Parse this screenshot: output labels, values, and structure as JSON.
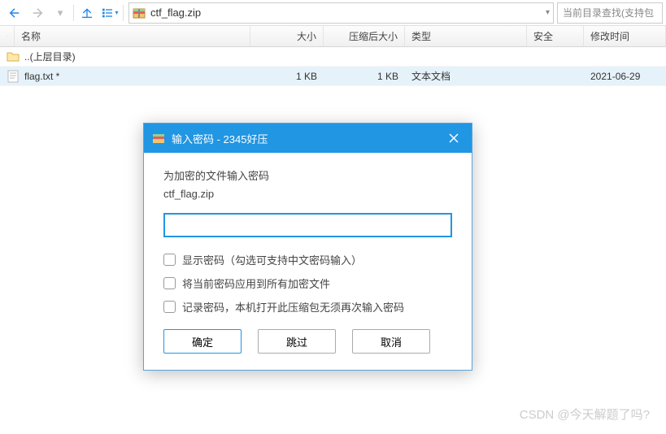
{
  "toolbar": {
    "path": "ctf_flag.zip",
    "search_placeholder": "当前目录查找(支持包"
  },
  "columns": {
    "name": "名称",
    "size": "大小",
    "csize": "压缩后大小",
    "type": "类型",
    "safe": "安全",
    "time": "修改时间"
  },
  "rows": [
    {
      "name": "..(上层目录)",
      "size": "",
      "csize": "",
      "type": "",
      "safe": "",
      "time": "",
      "icon": "folder"
    },
    {
      "name": "flag.txt *",
      "size": "1 KB",
      "csize": "1 KB",
      "type": "文本文档",
      "safe": "",
      "time": "2021-06-29",
      "icon": "text"
    }
  ],
  "dialog": {
    "title": "输入密码 - 2345好压",
    "message": "为加密的文件输入密码",
    "filename": "ctf_flag.zip",
    "chk1": "显示密码（勾选可支持中文密码输入）",
    "chk2": "将当前密码应用到所有加密文件",
    "chk3": "记录密码，本机打开此压缩包无须再次输入密码",
    "ok": "确定",
    "skip": "跳过",
    "cancel": "取消"
  },
  "watermark": "CSDN @今天解题了吗?"
}
